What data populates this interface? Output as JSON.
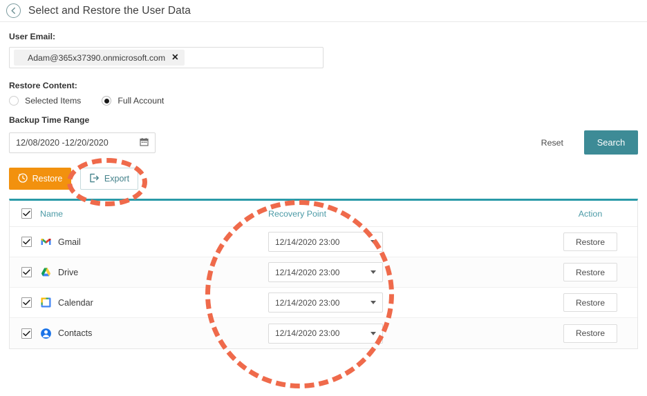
{
  "header": {
    "title": "Select and Restore the User Data",
    "back_icon": "arrow-left-circle-icon"
  },
  "form": {
    "user_email_label": "User Email:",
    "user_email_chip": "Adam@365x37390.onmicrosoft.com",
    "user_email_chip_remove": "✕",
    "restore_content_label": "Restore Content:",
    "restore_content_options": [
      {
        "label": "Selected Items",
        "selected": false
      },
      {
        "label": "Full Account",
        "selected": true
      }
    ],
    "backup_time_range_label": "Backup Time Range",
    "backup_time_range_value": "12/08/2020 -12/20/2020",
    "calendar_icon": "calendar-icon",
    "reset_label": "Reset",
    "search_label": "Search"
  },
  "toolbar": {
    "restore_label": "Restore",
    "restore_icon": "clock-restore-icon",
    "export_label": "Export",
    "export_icon": "export-arrow-icon"
  },
  "table": {
    "columns": [
      "Name",
      "Recovery Point",
      "Action"
    ],
    "header_checkbox_checked": true,
    "rows": [
      {
        "checked": true,
        "icon": "gmail-icon",
        "name": "Gmail",
        "recovery_point": "12/14/2020 23:00",
        "action_label": "Restore"
      },
      {
        "checked": true,
        "icon": "drive-icon",
        "name": "Drive",
        "recovery_point": "12/14/2020 23:00",
        "action_label": "Restore"
      },
      {
        "checked": true,
        "icon": "calendar-app-icon",
        "name": "Calendar",
        "recovery_point": "12/14/2020 23:00",
        "action_label": "Restore"
      },
      {
        "checked": true,
        "icon": "contacts-icon",
        "name": "Contacts",
        "recovery_point": "12/14/2020 23:00",
        "action_label": "Restore"
      }
    ]
  },
  "annotations": [
    {
      "name": "export-button-highlight",
      "shape": "dashed-ellipse",
      "color": "#ef6a4b"
    },
    {
      "name": "recovery-point-column-highlight",
      "shape": "dashed-circle",
      "color": "#ef6a4b"
    }
  ],
  "colors": {
    "teal": "#3d8b96",
    "table_top_rule": "#2a9aa8",
    "orange_button": "#f2910e",
    "annotation": "#ef6a4b",
    "header_text": "#4b9aa6"
  }
}
